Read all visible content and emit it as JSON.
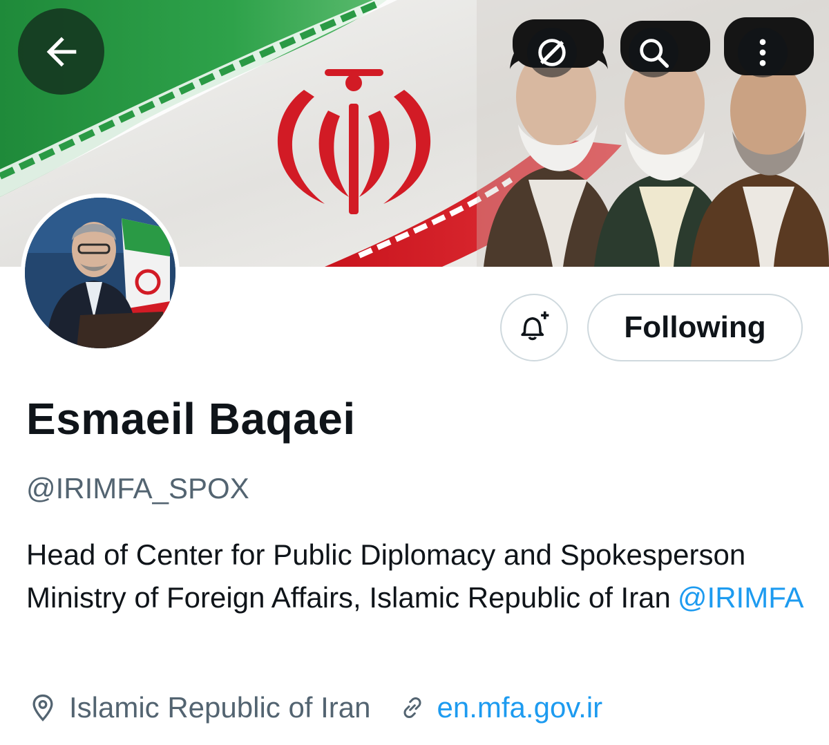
{
  "header": {
    "back_icon": "arrow-left-icon",
    "grok_icon": "grok-icon",
    "search_icon": "search-icon",
    "more_icon": "more-vertical-icon"
  },
  "profile": {
    "name": "Esmaeil Baqaei",
    "handle": "@IRIMFA_SPOX",
    "bio_text": "Head of Center for Public Diplomacy and Spokesperson  Ministry of Foreign Affairs, Islamic Republic of Iran",
    "bio_mention": "@IRIMFA",
    "location": "Islamic Republic of Iran",
    "website": "en.mfa.gov.ir"
  },
  "actions": {
    "notify_icon": "bell-plus-icon",
    "follow_label": "Following"
  },
  "colors": {
    "accent": "#1d9bf0",
    "text_primary": "#0f1419",
    "text_secondary": "#536471",
    "border": "#cfd9de",
    "flag_green": "#239f40",
    "flag_red": "#da0000"
  }
}
